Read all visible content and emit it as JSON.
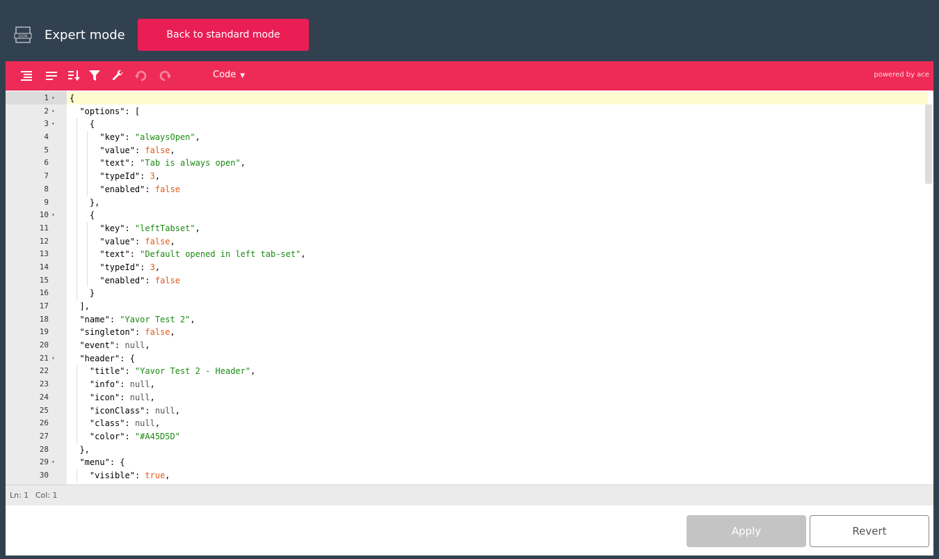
{
  "header": {
    "title": "Expert mode",
    "back_label": "Back to standard mode"
  },
  "toolbar": {
    "icons": [
      "format-icon",
      "compact-icon",
      "sort-icon",
      "filter-icon",
      "repair-icon",
      "undo-icon",
      "redo-icon"
    ],
    "mode_label": "Code",
    "powered_label": "powered by ace"
  },
  "editor": {
    "lines": [
      {
        "n": "1",
        "fold": "▾",
        "code": "{"
      },
      {
        "n": "2",
        "fold": "▾",
        "code": "  \"options\": ["
      },
      {
        "n": "3",
        "fold": "▾",
        "code": "    {"
      },
      {
        "n": "4",
        "code": "      \"key\": \"alwaysOpen\","
      },
      {
        "n": "5",
        "code": "      \"value\": false,"
      },
      {
        "n": "6",
        "code": "      \"text\": \"Tab is always open\","
      },
      {
        "n": "7",
        "code": "      \"typeId\": 3,"
      },
      {
        "n": "8",
        "code": "      \"enabled\": false"
      },
      {
        "n": "9",
        "code": "    },"
      },
      {
        "n": "10",
        "fold": "▾",
        "code": "    {"
      },
      {
        "n": "11",
        "code": "      \"key\": \"leftTabset\","
      },
      {
        "n": "12",
        "code": "      \"value\": false,"
      },
      {
        "n": "13",
        "code": "      \"text\": \"Default opened in left tab-set\","
      },
      {
        "n": "14",
        "code": "      \"typeId\": 3,"
      },
      {
        "n": "15",
        "code": "      \"enabled\": false"
      },
      {
        "n": "16",
        "code": "    }"
      },
      {
        "n": "17",
        "code": "  ],"
      },
      {
        "n": "18",
        "code": "  \"name\": \"Yavor Test 2\","
      },
      {
        "n": "19",
        "code": "  \"singleton\": false,"
      },
      {
        "n": "20",
        "code": "  \"event\": null,"
      },
      {
        "n": "21",
        "fold": "▾",
        "code": "  \"header\": {"
      },
      {
        "n": "22",
        "code": "    \"title\": \"Yavor Test 2 - Header\","
      },
      {
        "n": "23",
        "code": "    \"info\": null,"
      },
      {
        "n": "24",
        "code": "    \"icon\": null,"
      },
      {
        "n": "25",
        "code": "    \"iconClass\": null,"
      },
      {
        "n": "26",
        "code": "    \"class\": null,"
      },
      {
        "n": "27",
        "code": "    \"color\": \"#A45D5D\""
      },
      {
        "n": "28",
        "code": "  },"
      },
      {
        "n": "29",
        "fold": "▾",
        "code": "  \"menu\": {"
      },
      {
        "n": "30",
        "code": "    \"visible\": true,"
      }
    ]
  },
  "status": {
    "ln_label": "Ln: 1",
    "col_label": "Col: 1"
  },
  "footer": {
    "apply_label": "Apply",
    "revert_label": "Revert"
  },
  "colors": {
    "header_bg": "#324150",
    "accent": "#ee2b57",
    "button_accent": "#e91e55",
    "string": "#1a8a10",
    "boolean_number": "#e05a1a",
    "active_line": "#fffbd1"
  }
}
